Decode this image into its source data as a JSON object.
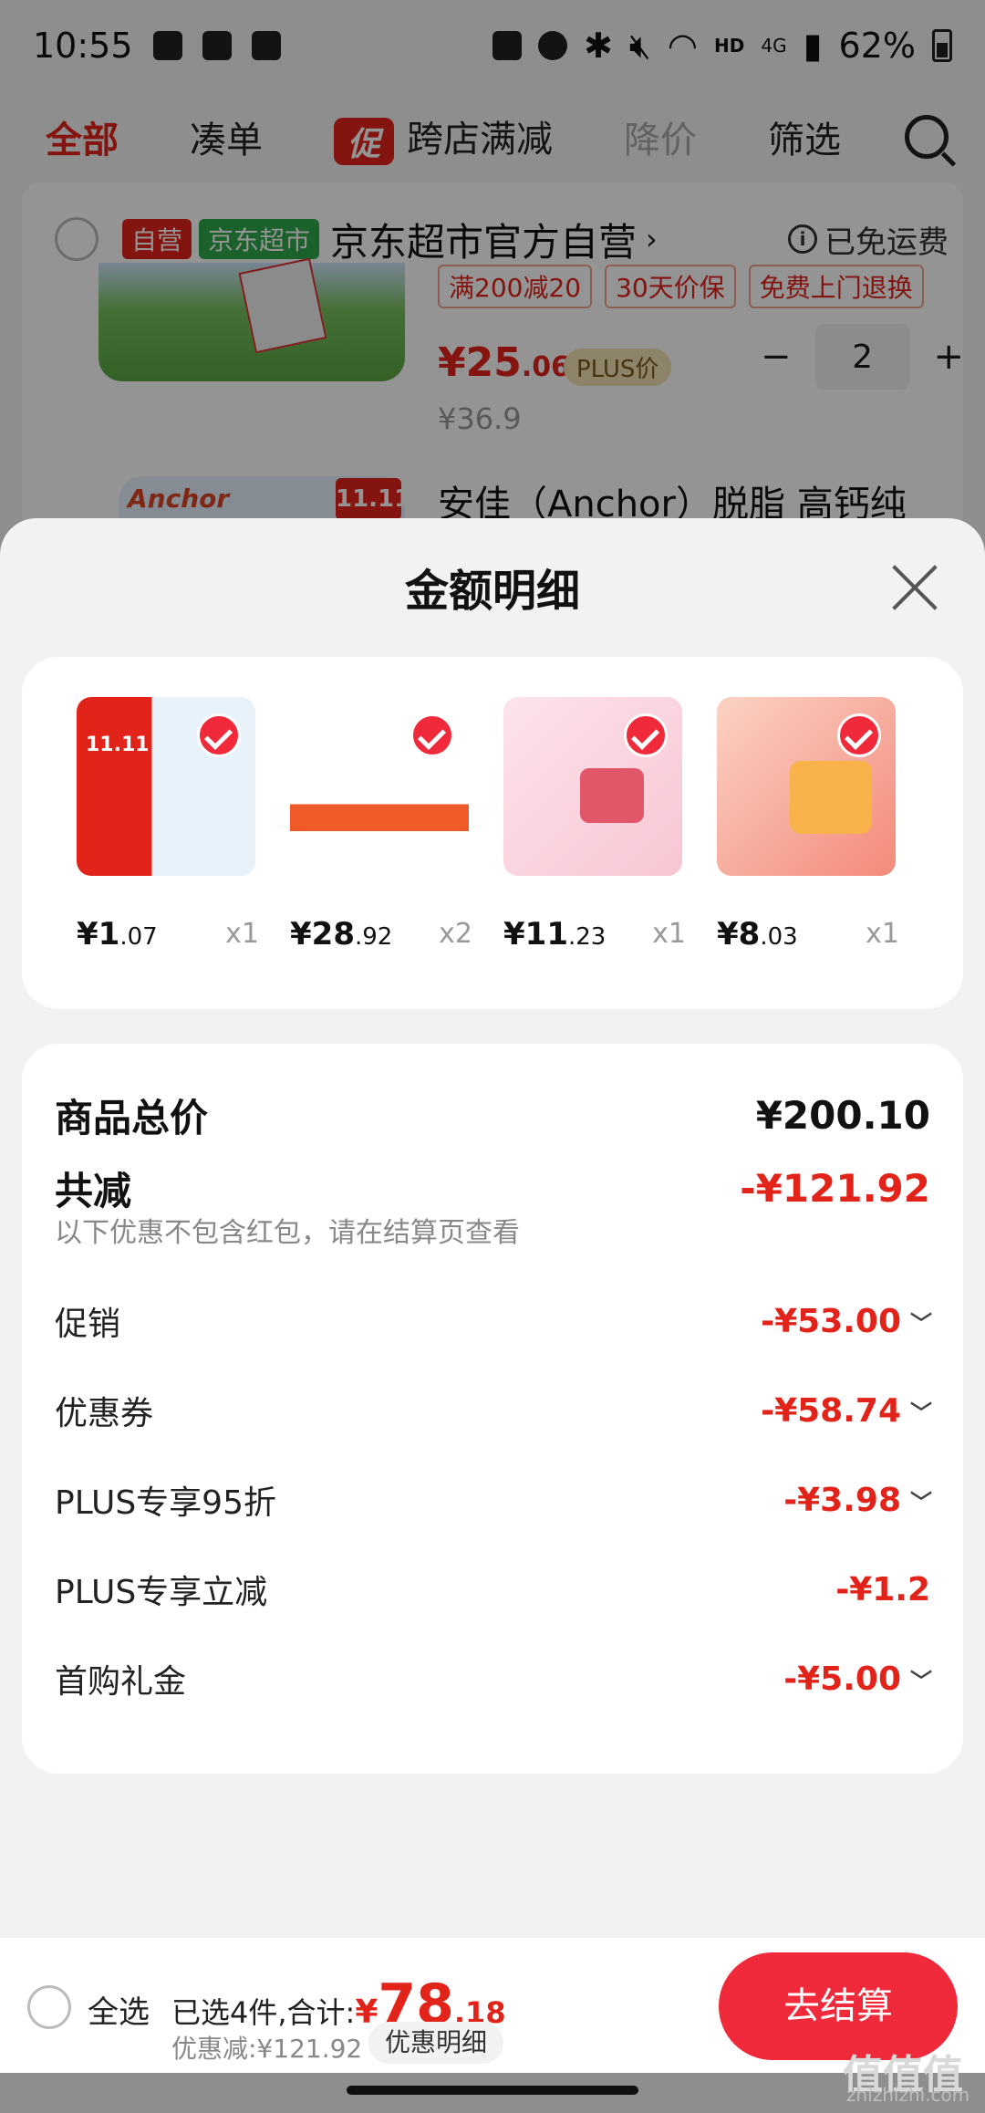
{
  "status_bar": {
    "time": "10:55",
    "battery": "62%",
    "network": "4G",
    "hd": "HD"
  },
  "tabs": [
    {
      "label": "全部"
    },
    {
      "label": "凑单"
    },
    {
      "label": "跨店满减",
      "badge": "促"
    },
    {
      "label": "降价"
    },
    {
      "label": "筛选"
    }
  ],
  "store": {
    "tag_self": "自营",
    "tag_market": "京东超市",
    "name": "京东超市官方自营",
    "arrow": "›",
    "shipping": "已免运费",
    "promo_tags": [
      "满200减20",
      "30天价保",
      "免费上门退换"
    ],
    "price_int": "¥25",
    "price_dec": ".06",
    "plus_tag": "PLUS价",
    "old_price": "¥36.9",
    "quantity": "2",
    "minus": "−",
    "plus": "+",
    "next_item_title": "安佳（Anchor）脱脂 高钙纯",
    "next_item_brand": "Anchor",
    "next_item_badge": "11.11"
  },
  "sheet": {
    "title": "金额明细",
    "products": [
      {
        "price_int": "¥1",
        "price_dec": ".07",
        "qty": "x1",
        "colors": [
          "#ffffff",
          "#e8f2fa"
        ],
        "accent": "#e2231a"
      },
      {
        "price_int": "¥28",
        "price_dec": ".92",
        "qty": "x2",
        "colors": [
          "#ffffff",
          "#fde8e0"
        ],
        "accent": "#f05a28"
      },
      {
        "price_int": "¥11",
        "price_dec": ".23",
        "qty": "x1",
        "colors": [
          "#fde3ea",
          "#f7c6d3"
        ],
        "accent": "#e2566a"
      },
      {
        "price_int": "¥8",
        "price_dec": ".03",
        "qty": "x1",
        "colors": [
          "#fbd2c4",
          "#f38a7a"
        ],
        "accent": "#e2231a"
      }
    ],
    "total_label": "商品总价",
    "total_value": "¥200.10",
    "minus_label": "共减",
    "minus_value": "-¥121.92",
    "hint": "以下优惠不包含红包，请在结算页查看",
    "items": [
      {
        "label": "促销",
        "value": "-¥53.00",
        "chevron": true
      },
      {
        "label": "优惠券",
        "value": "-¥58.74",
        "chevron": true
      },
      {
        "label": "PLUS专享95折",
        "value": "-¥3.98",
        "chevron": true
      },
      {
        "label": "PLUS专享立减",
        "value": "-¥1.2",
        "chevron": false
      },
      {
        "label": "首购礼金",
        "value": "-¥5.00",
        "chevron": true
      }
    ]
  },
  "footer": {
    "select_all": "全选",
    "summary_prefix": "已选4件,合计:",
    "sum_currency": "¥",
    "sum_int": "78",
    "sum_dec": ".18",
    "discount": "优惠减:¥121.92",
    "detail_button": "优惠明细",
    "checkout": "去结算"
  },
  "watermark": {
    "main": "值值值",
    "sub": "zhizhizhi.com"
  },
  "colors": {
    "accent": "#e2231a",
    "checkout": "#f02a3a",
    "green_tag": "#2ea74a"
  }
}
